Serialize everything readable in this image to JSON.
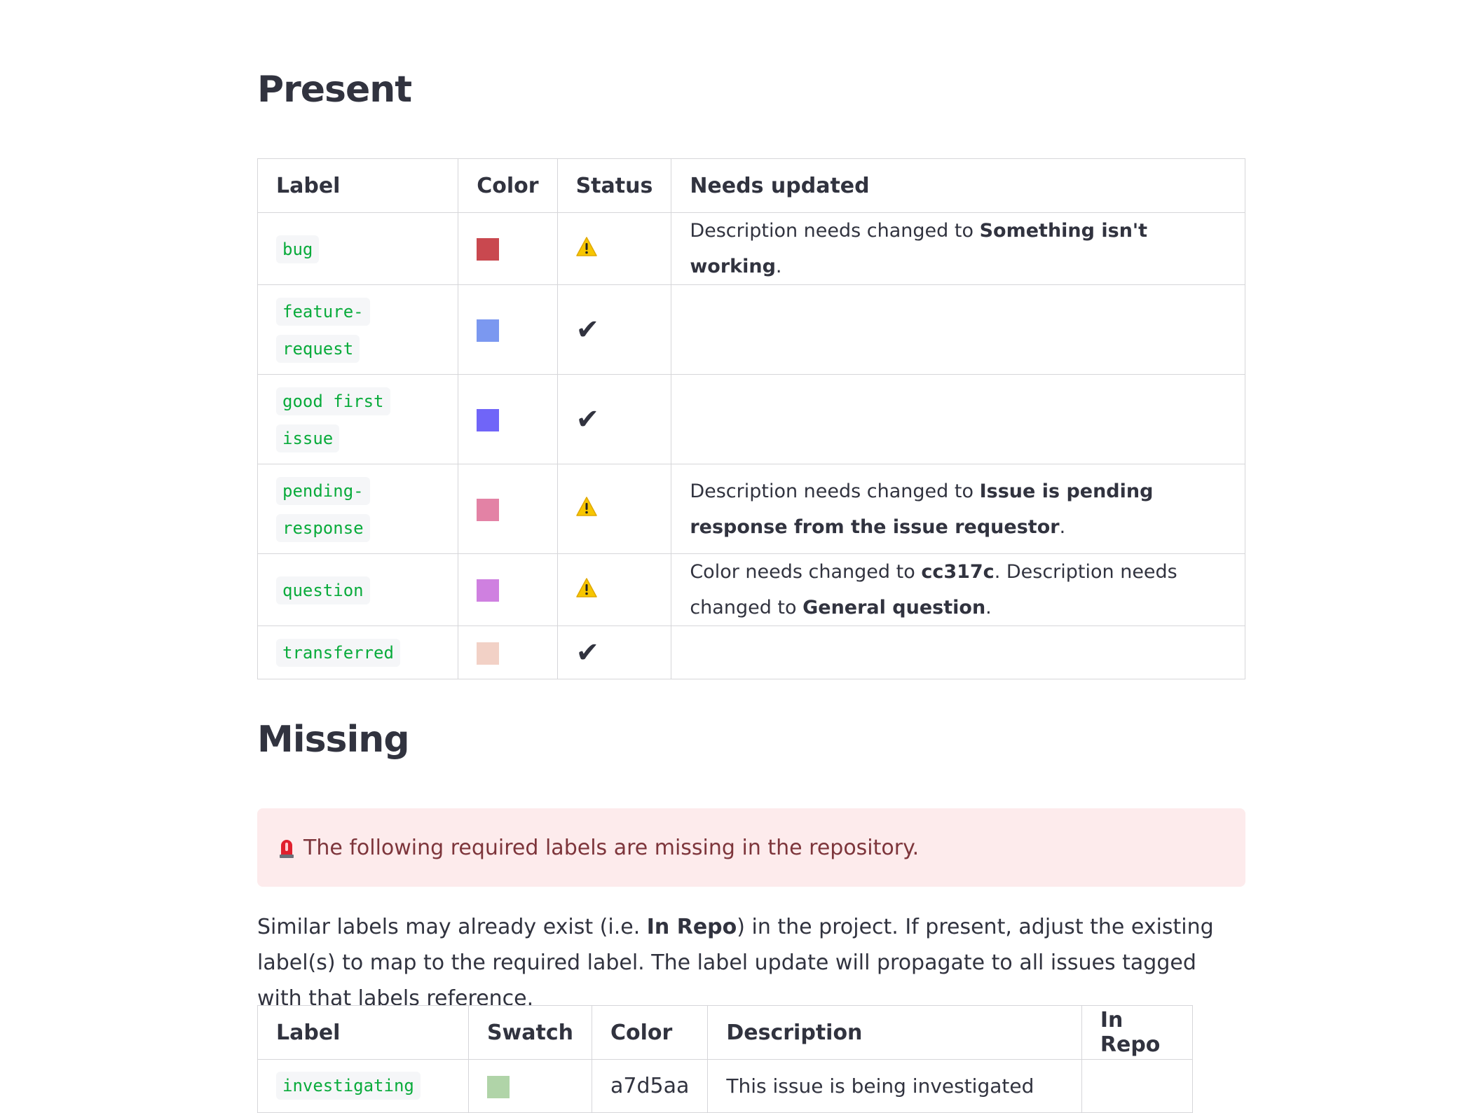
{
  "present": {
    "title": "Present",
    "headers": {
      "label": "Label",
      "color": "Color",
      "status": "Status",
      "needs": "Needs updated"
    },
    "rows": [
      {
        "label": "bug",
        "swatch": "#c9484f",
        "status": "warning",
        "prefix": "Description needs changed to ",
        "bold1": "Something isn't working",
        "mid": "",
        "bold2": "",
        "suffix": "."
      },
      {
        "label": "feature-request",
        "swatch": "#7b98f0",
        "status": "check",
        "prefix": "",
        "bold1": "",
        "mid": "",
        "bold2": "",
        "suffix": ""
      },
      {
        "label": "good first issue",
        "swatch": "#7065f8",
        "status": "check",
        "prefix": "",
        "bold1": "",
        "mid": "",
        "bold2": "",
        "suffix": ""
      },
      {
        "label": "pending-response",
        "swatch": "#e382a5",
        "status": "warning",
        "prefix": "Description needs changed to ",
        "bold1": "Issue is pending response from the issue requestor",
        "mid": "",
        "bold2": "",
        "suffix": "."
      },
      {
        "label": "question",
        "swatch": "#cf80e0",
        "status": "warning",
        "prefix": "Color needs changed to ",
        "bold1": "cc317c",
        "mid": ". Description needs changed to ",
        "bold2": "General question",
        "suffix": "."
      },
      {
        "label": "transferred",
        "swatch": "#f2d1c6",
        "status": "check",
        "prefix": "",
        "bold1": "",
        "mid": "",
        "bold2": "",
        "suffix": ""
      }
    ]
  },
  "missing": {
    "title": "Missing",
    "alert_text": "The following required labels are missing in the repository.",
    "paragraph": {
      "before": "Similar labels may already exist (i.e. ",
      "bold": "In Repo",
      "after": ") in the project. If present, adjust the existing label(s) to map to the required label. The label update will propagate to all issues tagged with that labels reference."
    },
    "headers": {
      "label": "Label",
      "swatch": "Swatch",
      "color": "Color",
      "description": "Description",
      "in_repo": "In Repo"
    },
    "rows": [
      {
        "label": "investigating",
        "swatch": "#b0d4a8",
        "color": "a7d5aa",
        "description": "This issue is being investigated",
        "in_repo": ""
      }
    ]
  },
  "colors": {
    "text": "#31333f",
    "code": "#09ab3b",
    "alert_bg": "#fdebec",
    "alert_text": "#7d353b",
    "border": "#d6d6d9"
  }
}
